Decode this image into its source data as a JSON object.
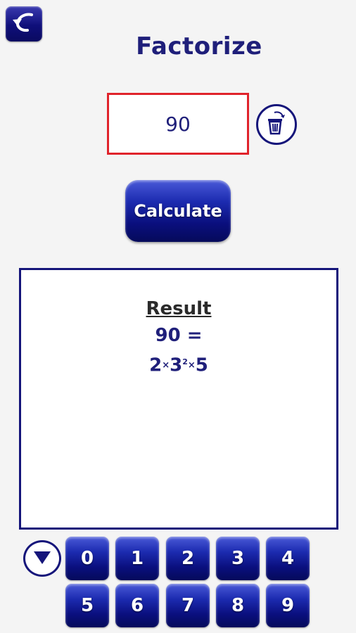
{
  "header": {
    "title": "Factorize",
    "back_icon": "undo-arrow-icon"
  },
  "input": {
    "value": "90",
    "clear_icon": "trash-icon"
  },
  "actions": {
    "calculate_label": "Calculate"
  },
  "result": {
    "heading": "Result",
    "equation": "90 =",
    "factors": [
      {
        "base": "2",
        "exp": ""
      },
      {
        "base": "3",
        "exp": "2"
      },
      {
        "base": "5",
        "exp": ""
      }
    ],
    "times_symbol": "×"
  },
  "keypad": {
    "hide_icon": "triangle-down-icon",
    "keys": [
      "0",
      "1",
      "2",
      "3",
      "4",
      "5",
      "6",
      "7",
      "8",
      "9"
    ]
  },
  "colors": {
    "primary": "#15157a",
    "accent_border": "#e0232b",
    "background": "#f4f4f4"
  }
}
